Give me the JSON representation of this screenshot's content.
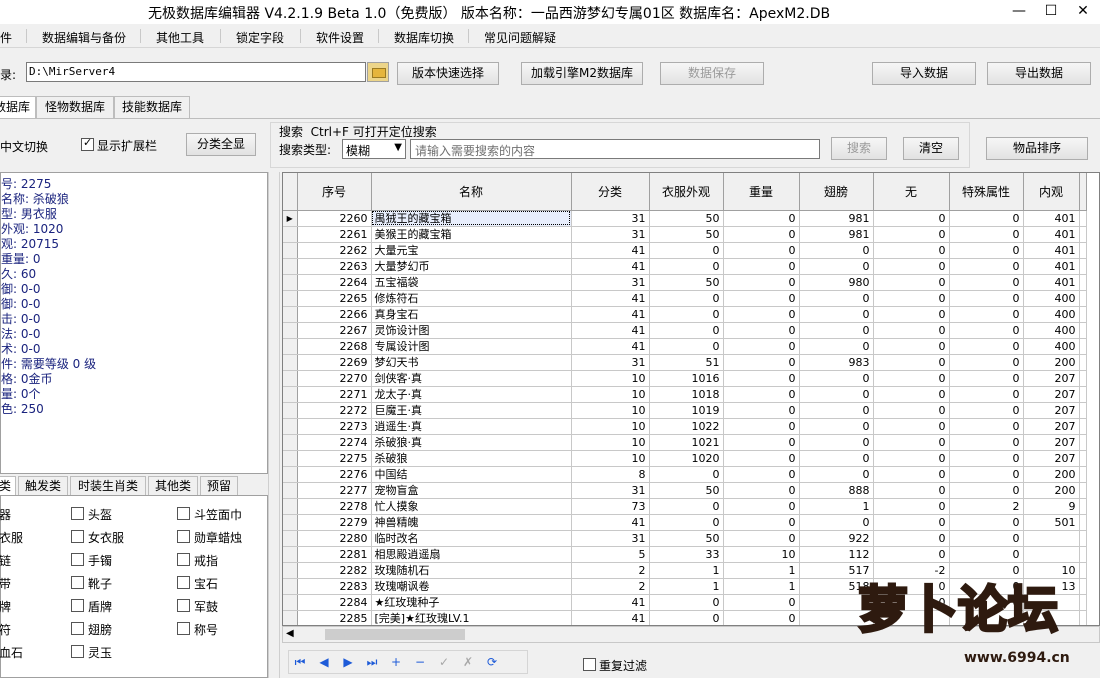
{
  "window": {
    "title": "无极数据库编辑器 V4.2.1.9   Beta 1.0（免费版）   版本名称：一品西游梦幻专属01区    数据库名：ApexM2.DB",
    "min": "—",
    "max": "☐",
    "close": "✕"
  },
  "menu": [
    "件",
    "数据编辑与备份",
    "其他工具",
    "锁定字段",
    "软件设置",
    "数据库切换",
    "常见问题解疑"
  ],
  "toolbar": {
    "dir_label": "录:",
    "dir_value": "D:\\MirServer4",
    "quick_select": "版本快速选择",
    "load_engine": "加载引擎M2数据库",
    "save_data": "数据保存",
    "import": "导入数据",
    "export": "导出数据"
  },
  "tabs": [
    "数据库",
    "怪物数据库",
    "技能数据库"
  ],
  "options": {
    "cn_switch": "中文切换",
    "show_ext": "显示扩展栏",
    "show_all_btn": "分类全显"
  },
  "search": {
    "title": "搜索  Ctrl+F 可打开定位搜索",
    "type_label": "搜索类型:",
    "type_value": "模糊",
    "placeholder": "请输入需要搜索的内容",
    "search_btn": "搜索",
    "clear_btn": "清空",
    "sort_btn": "物品排序"
  },
  "details": [
    "号: 2275",
    "名称: 杀破狼",
    "型: 男衣服",
    "外观: 1020",
    "观: 20715",
    "重量: 0",
    "久: 60",
    "御: 0-0",
    "御: 0-0",
    "击: 0-0",
    "法: 0-0",
    "术: 0-0",
    "件: 需要等级 0 级",
    "格: 0金币",
    "量: 0个",
    "色: 250"
  ],
  "category_tabs": [
    "类",
    "触发类",
    "时装生肖类",
    "其他类",
    "预留"
  ],
  "categories": [
    [
      "器",
      "头盔",
      "斗笠面巾"
    ],
    [
      "衣服",
      "女衣服",
      "勋章蜡烛"
    ],
    [
      "链",
      "手镯",
      "戒指"
    ],
    [
      "带",
      "靴子",
      "宝石"
    ],
    [
      "牌",
      "盾牌",
      "军鼓"
    ],
    [
      "符",
      "翅膀",
      "称号"
    ],
    [
      "血石",
      "灵玉",
      ""
    ]
  ],
  "grid": {
    "columns": [
      "序号",
      "名称",
      "分类",
      "衣服外观",
      "重量",
      "翅膀",
      "无",
      "特殊属性",
      "内观"
    ],
    "rows": [
      [
        "2260",
        "禺狨王的藏宝箱",
        "31",
        "50",
        "0",
        "981",
        "0",
        "0",
        "401"
      ],
      [
        "2261",
        "美猴王的藏宝箱",
        "31",
        "50",
        "0",
        "981",
        "0",
        "0",
        "401"
      ],
      [
        "2262",
        "大量元宝",
        "41",
        "0",
        "0",
        "0",
        "0",
        "0",
        "401"
      ],
      [
        "2263",
        "大量梦幻币",
        "41",
        "0",
        "0",
        "0",
        "0",
        "0",
        "401"
      ],
      [
        "2264",
        "五宝福袋",
        "31",
        "50",
        "0",
        "980",
        "0",
        "0",
        "401"
      ],
      [
        "2265",
        "修炼符石",
        "41",
        "0",
        "0",
        "0",
        "0",
        "0",
        "400"
      ],
      [
        "2266",
        "真身宝石",
        "41",
        "0",
        "0",
        "0",
        "0",
        "0",
        "400"
      ],
      [
        "2267",
        "灵饰设计图",
        "41",
        "0",
        "0",
        "0",
        "0",
        "0",
        "400"
      ],
      [
        "2268",
        "专属设计图",
        "41",
        "0",
        "0",
        "0",
        "0",
        "0",
        "400"
      ],
      [
        "2269",
        "梦幻天书",
        "31",
        "51",
        "0",
        "983",
        "0",
        "0",
        "200"
      ],
      [
        "2270",
        "剑侠客·真",
        "10",
        "1016",
        "0",
        "0",
        "0",
        "0",
        "207"
      ],
      [
        "2271",
        "龙太子·真",
        "10",
        "1018",
        "0",
        "0",
        "0",
        "0",
        "207"
      ],
      [
        "2272",
        "巨魔王·真",
        "10",
        "1019",
        "0",
        "0",
        "0",
        "0",
        "207"
      ],
      [
        "2273",
        "逍遥生·真",
        "10",
        "1022",
        "0",
        "0",
        "0",
        "0",
        "207"
      ],
      [
        "2274",
        "杀破狼·真",
        "10",
        "1021",
        "0",
        "0",
        "0",
        "0",
        "207"
      ],
      [
        "2275",
        "杀破狼",
        "10",
        "1020",
        "0",
        "0",
        "0",
        "0",
        "207"
      ],
      [
        "2276",
        "中国结",
        "8",
        "0",
        "0",
        "0",
        "0",
        "0",
        "200"
      ],
      [
        "2277",
        "宠物盲盒",
        "31",
        "50",
        "0",
        "888",
        "0",
        "0",
        "200"
      ],
      [
        "2278",
        "忙人摸象",
        "73",
        "0",
        "0",
        "1",
        "0",
        "2",
        "9"
      ],
      [
        "2279",
        "神兽精魄",
        "41",
        "0",
        "0",
        "0",
        "0",
        "0",
        "501"
      ],
      [
        "2280",
        "临时改名",
        "31",
        "50",
        "0",
        "922",
        "0",
        "0",
        ""
      ],
      [
        "2281",
        "相思殿逍遥扇",
        "5",
        "33",
        "10",
        "112",
        "0",
        "0",
        ""
      ],
      [
        "2282",
        "玫瑰随机石",
        "2",
        "1",
        "1",
        "517",
        "-2",
        "0",
        "10"
      ],
      [
        "2283",
        "玫瑰嘲讽卷",
        "2",
        "1",
        "1",
        "518",
        "0",
        "0",
        "13"
      ],
      [
        "2284",
        "★红玫瑰种子",
        "41",
        "0",
        "0",
        "0",
        "0",
        "0",
        ""
      ],
      [
        "2285",
        "[完美]★红玫瑰LV.1",
        "41",
        "0",
        "0",
        "",
        "",
        "",
        ""
      ]
    ]
  },
  "nav": [
    "⏮",
    "◀",
    "▶",
    "⏭",
    "+",
    "−",
    "✓",
    "✗",
    "⟳"
  ],
  "repeat_filter": "重复过滤",
  "watermark": {
    "logo": "萝卜论坛",
    "url": "www.6994.cn"
  }
}
